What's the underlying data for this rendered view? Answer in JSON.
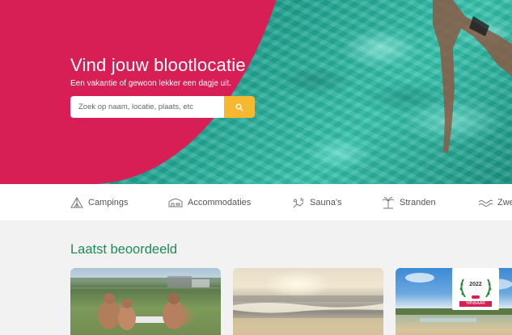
{
  "hero": {
    "title": "Vind jouw blootlocatie",
    "subtitle": "Een vakantie of gewoon lekker een dagje uit.",
    "search_placeholder": "Zoek op naam, locatie, plaats, etc",
    "search_icon": "search-icon"
  },
  "nav": {
    "items": [
      {
        "label": "Campings",
        "icon": "tent-icon"
      },
      {
        "label": "Accommodaties",
        "icon": "house-icon"
      },
      {
        "label": "Sauna’s",
        "icon": "sauna-icon"
      },
      {
        "label": "Stranden",
        "icon": "palm-beach-icon"
      },
      {
        "label": "Zwe",
        "icon": "wave-icon"
      }
    ]
  },
  "section": {
    "title": "Laatst beoordeeld"
  },
  "cards": [
    {
      "image": "campsite-people"
    },
    {
      "image": "beach-sunset"
    },
    {
      "image": "lake-beach",
      "award": {
        "year": "2022",
        "label": "WINNAAR"
      }
    }
  ],
  "colors": {
    "brand_pink": "#d81f55",
    "search_button": "#f5b82e",
    "section_title": "#1e8a5a"
  }
}
